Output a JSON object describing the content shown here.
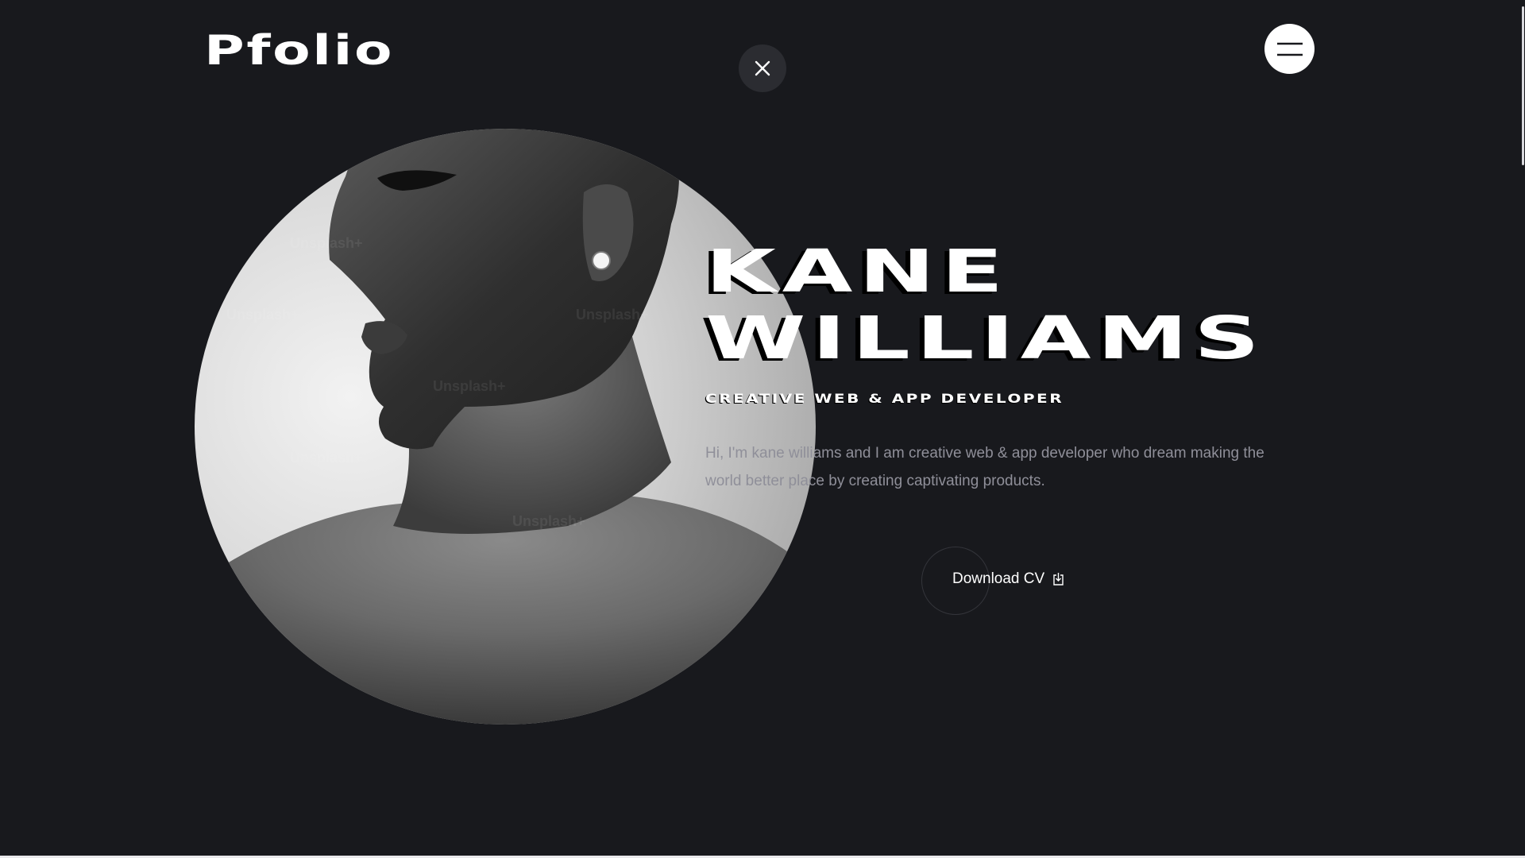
{
  "header": {
    "logo": "Pfolio",
    "close_icon": "close-icon",
    "menu_icon": "hamburger-menu-icon"
  },
  "hero": {
    "name_line1": "KANE",
    "name_line2": "WILLIAMS",
    "subtitle": "CREATIVE WEB & APP DEVELOPER",
    "bio": "Hi, I'm kane williams and I am creative web & app developer who dream making the world better place by creating captivating products.",
    "cta_label": "Download CV",
    "cta_icon": "download-icon",
    "watermark": "Unsplash+"
  },
  "colors": {
    "background": "#18191d",
    "text": "#ffffff",
    "muted": "#8f8f99",
    "close_bg": "#2b2c31"
  }
}
